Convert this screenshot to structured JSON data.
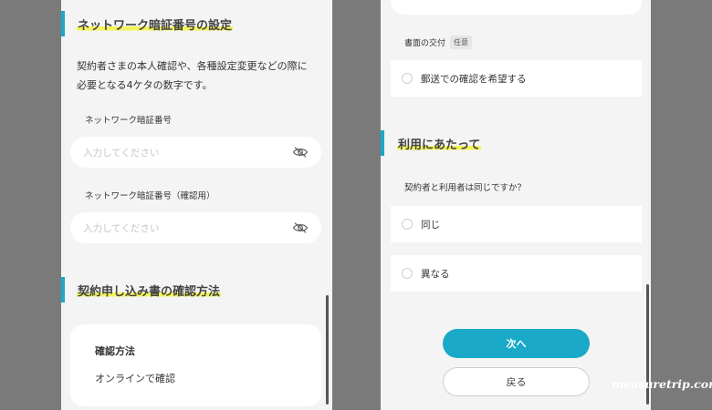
{
  "left": {
    "section1": {
      "title": "ネットワーク暗証番号の設定",
      "description_line1": "契約者さまの本人確認や、各種設定変更などの際に",
      "description_line2": "必要となる4ケタの数字です。"
    },
    "pin_field": {
      "label": "ネットワーク暗証番号",
      "placeholder": "入力してください"
    },
    "pin_confirm_field": {
      "label": "ネットワーク暗証番号（確認用）",
      "placeholder": "入力してください"
    },
    "section2": {
      "title": "契約申し込み書の確認方法",
      "card_heading": "確認方法",
      "card_value": "オンラインで確認"
    }
  },
  "right": {
    "delivery": {
      "label": "書面の交付",
      "badge": "任意",
      "option": "郵送での確認を希望する"
    },
    "section3": {
      "title": "利用にあたって",
      "question": "契約者と利用者は同じですか？",
      "options": [
        "同じ",
        "異なる"
      ]
    },
    "buttons": {
      "next": "次へ",
      "back": "戻る"
    }
  },
  "watermark": "measuretrip.com",
  "colors": {
    "accent": "#1aa9c8",
    "highlight": "#f3f35a",
    "backdrop": "#7a7a7a"
  }
}
